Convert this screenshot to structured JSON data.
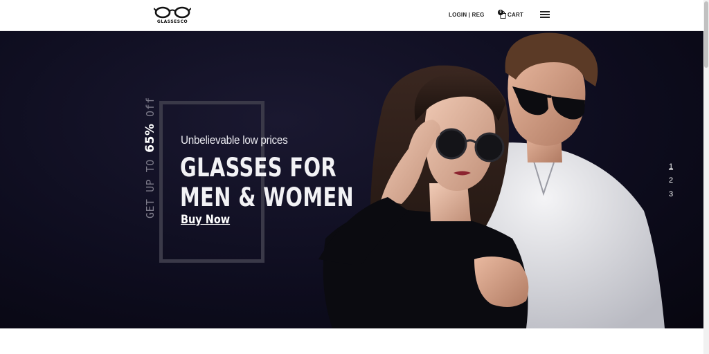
{
  "header": {
    "logo_text": "GLASSESCO",
    "login_label": "LOGIN | REG",
    "cart_label": "CART",
    "cart_count": "0",
    "menu_icon": "hamburger-icon",
    "cart_icon": "shopping-bag-icon"
  },
  "hero": {
    "promo_prefix": "GET UP TO ",
    "promo_amount": "65%",
    "promo_suffix": " Off",
    "subtitle": "Unbelievable low prices",
    "title_line1": "GLASSES FOR",
    "title_line2": "MEN & WOMEN",
    "cta_label": "Buy Now",
    "slides": [
      "1",
      "2",
      "3"
    ],
    "active_slide": 1,
    "background_color": "#0e0d1f",
    "image_description": "couple-wearing-sunglasses"
  }
}
